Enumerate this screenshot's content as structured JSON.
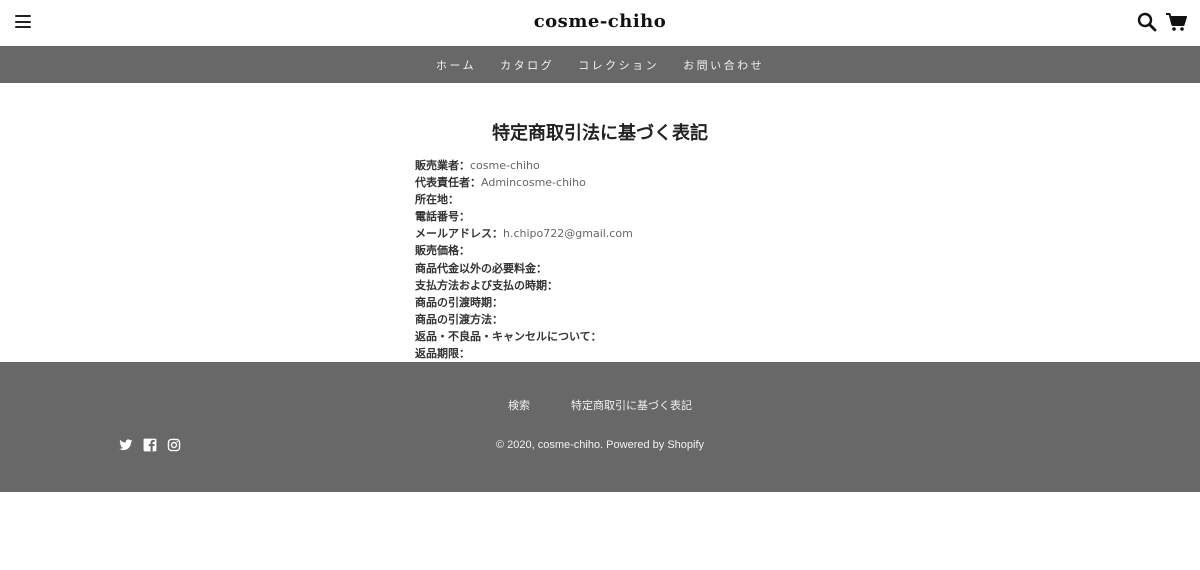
{
  "header": {
    "logo": "cosme-chiho",
    "menu_icon": "hamburger-menu-icon",
    "search_icon": "search-icon",
    "cart_icon": "cart-icon"
  },
  "nav": {
    "items": [
      {
        "label": "ホーム"
      },
      {
        "label": "カタログ"
      },
      {
        "label": "コレクション"
      },
      {
        "label": "お問い合わせ"
      }
    ]
  },
  "main": {
    "title": "特定商取引法に基づく表記",
    "rows": [
      {
        "label": "販売業者：",
        "value": "cosme-chiho"
      },
      {
        "label": "代表責任者：",
        "value": "Admincosme-chiho"
      },
      {
        "label": "所在地：",
        "value": ""
      },
      {
        "label": "電話番号：",
        "value": ""
      },
      {
        "label": "メールアドレス：",
        "value": "h.chipo722@gmail.com"
      },
      {
        "label": "販売価格：",
        "value": ""
      },
      {
        "label": "商品代金以外の必要料金：",
        "value": ""
      },
      {
        "label": "支払方法および支払の時期：",
        "value": ""
      },
      {
        "label": "商品の引渡時期：",
        "value": ""
      },
      {
        "label": "商品の引渡方法：",
        "value": ""
      },
      {
        "label": "返品・不良品・キャンセルについて：",
        "value": ""
      },
      {
        "label": "返品期限：",
        "value": ""
      }
    ]
  },
  "footer": {
    "links": [
      {
        "label": "検索"
      },
      {
        "label": "特定商取引に基づく表記"
      }
    ],
    "copyright": "© 2020, cosme-chiho. Powered by Shopify",
    "social_icons": [
      "twitter-icon",
      "facebook-icon",
      "instagram-icon"
    ]
  },
  "colors": {
    "nav_bg": "#686868",
    "footer_bg": "#686868",
    "text_light": "#f2f2f2"
  }
}
